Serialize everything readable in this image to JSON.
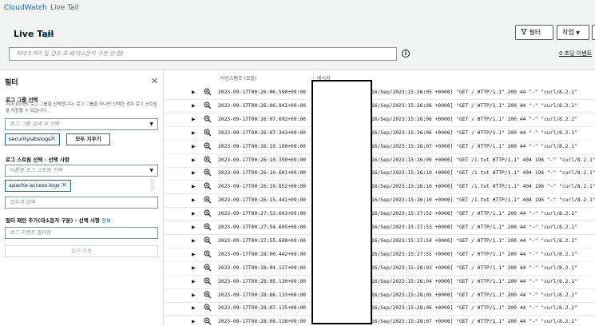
{
  "breadcrumb": {
    "root": "CloudWatch",
    "current": "Live Tail"
  },
  "header": {
    "title": "Live Tail",
    "info": "정보",
    "filter_button": "필터",
    "action_button": "작업",
    "search_placeholder": "최대 5개의 릴 검조 표새(대소문자 구분 안 함)",
    "events_rate": "0 초당 이벤트"
  },
  "panel": {
    "title": "필터",
    "log_group_label": "로그 그룹 선택",
    "log_group_desc": "최대 10개의 로그 그룹을 선택합니다. 로그 그룹을 하나만 선택한 경우 로그 스트림을 지정할 수 있습니다.",
    "log_group_placeholder": "로그 그룹 검색 및 선택",
    "log_group_token": "securitylabslogs",
    "clear_all": "모두 지우기",
    "log_stream_label": "로그 스트림 선택 - 선택 사항",
    "log_stream_placeholder": "이름별 로그 스트림 선택",
    "log_stream_token": "apache-access-logs",
    "prefix_placeholder": "접두사 입력",
    "pattern_label": "필터 패턴 추가(대소문자 구분) - 선택 사항",
    "pattern_info": "정보",
    "pattern_placeholder": "로그 이벤트 필터링",
    "apply_button": "필터 적용"
  },
  "table": {
    "col_timestamp": "타임스탬프 (로컬)",
    "col_message": "메시지",
    "rows": [
      {
        "ts": "2023-09-17T00:26:06.590+09:00",
        "msg": "16/Sep/2023:15:26:05 +0000] \"GET / HTTP/1.1\" 200 44 \"-\" \"curl/8.2.1\""
      },
      {
        "ts": "2023-09-17T00:26:06.841+09:00",
        "msg": "16/Sep/2023:15:26:06 +0000] \"GET / HTTP/1.1\" 200 44 \"-\" \"curl/8.2.1\""
      },
      {
        "ts": "2023-09-17T00:26:07.092+09:00",
        "msg": "16/Sep/2023:15:26:06 +0000] \"GET / HTTP/1.1\" 200 44 \"-\" \"curl/8.2.1\""
      },
      {
        "ts": "2023-09-17T00:26:07.343+09:00",
        "msg": "16/Sep/2023:15:26:06 +0000] \"GET / HTTP/1.1\" 200 44 \"-\" \"curl/8.2.1\""
      },
      {
        "ts": "2023-09-17T00:26:10.100+09:00",
        "msg": "16/Sep/2023:15:26:07 +0000] \"GET / HTTP/1.1\" 200 44 \"-\" \"curl/8.2.1\""
      },
      {
        "ts": "2023-09-17T00:26:10.350+09:00",
        "msg": "16/Sep/2023:15:26:09 +0000] \"GET /1.txt HTTP/1.1\" 404 196 \"-\" \"curl/8.2.1\""
      },
      {
        "ts": "2023-09-17T00:26:10.601+09:00",
        "msg": "16/Sep/2023:15:26:10 +0000] \"GET /1.txt HTTP/1.1\" 404 196 \"-\" \"curl/8.2.1\""
      },
      {
        "ts": "2023-09-17T00:26:10.852+09:00",
        "msg": "16/Sep/2023:15:26:10 +0000] \"GET /1.txt HTTP/1.1\" 404 196 \"-\" \"curl/8.2.1\""
      },
      {
        "ts": "2023-09-17T00:26:15.441+09:00",
        "msg": "16/Sep/2023:15:26:10 +0000] \"GET /1.txt HTTP/1.1\" 404 196 \"-\" \"curl/8.2.1\""
      },
      {
        "ts": "2023-09-17T00:27:53.603+09:00",
        "msg": "16/Sep/2023:15:27:52 +0000] \"GET / HTTP/1.1\" 200 44 \"-\" \"curl/8.2.1\""
      },
      {
        "ts": "2023-09-17T00:27:54.605+09:00",
        "msg": "16/Sep/2023:15:27:53 +0000] \"GET / HTTP/1.1\" 200 44 \"-\" \"curl/8.2.1\""
      },
      {
        "ts": "2023-09-17T00:27:55.608+09:00",
        "msg": "16/Sep/2023:15:27:54 +0000] \"GET / HTTP/1.1\" 200 44 \"-\" \"curl/8.2.1\""
      },
      {
        "ts": "2023-09-17T00:28:00.442+09:00",
        "msg": "16/Sep/2023:15:27:55 +0000] \"GET / HTTP/1.1\" 200 44 \"-\" \"curl/8.2.1\""
      },
      {
        "ts": "2023-09-17T00:28:04.127+09:00",
        "msg": "16/Sep/2023:15:28:03 +0000] \"GET / HTTP/1.1\" 200 44 \"-\" \"curl/8.2.1\""
      },
      {
        "ts": "2023-09-17T00:28:05.130+09:00",
        "msg": "16/Sep/2023:15:28:04 +0000] \"GET / HTTP/1.1\" 200 44 \"-\" \"curl/8.2.1\""
      },
      {
        "ts": "2023-09-17T00:28:06.133+09:00",
        "msg": "16/Sep/2023:15:28:05 +0000] \"GET / HTTP/1.1\" 200 44 \"-\" \"curl/8.2.1\""
      },
      {
        "ts": "2023-09-17T00:28:07.135+09:00",
        "msg": "16/Sep/2023:15:28:06 +0000] \"GET / HTTP/1.1\" 200 44 \"-\" \"curl/8.2.1\""
      },
      {
        "ts": "2023-09-17T00:28:08.138+09:00",
        "msg": "16/Sep/2023:15:28:07 +0000] \"GET / HTTP/1.1\" 200 44 \"-\" \"curl/8.2.1\""
      }
    ]
  },
  "colors": {
    "link": "#0073bb",
    "border": "#879596",
    "bg": "#f2f3f3"
  }
}
